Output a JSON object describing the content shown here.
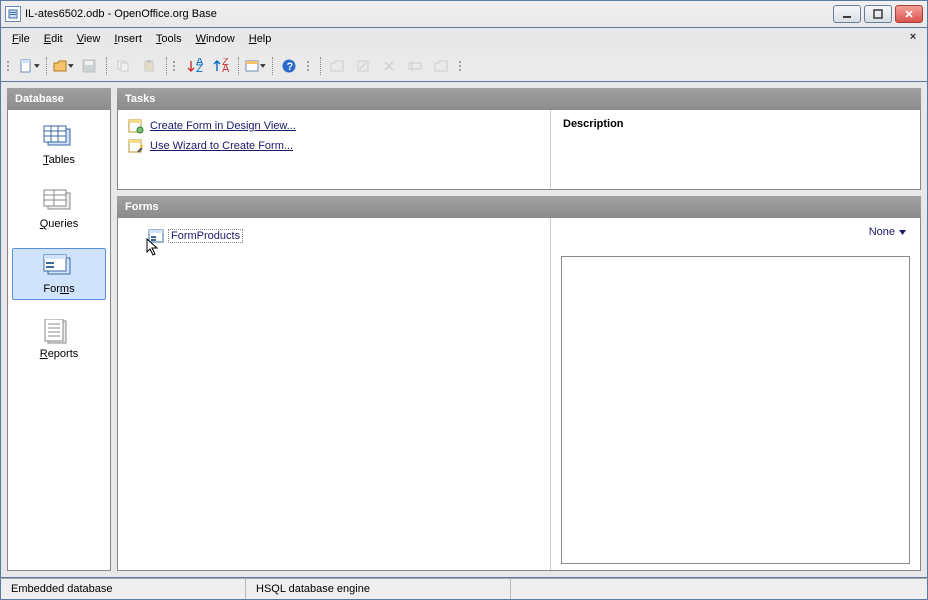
{
  "window": {
    "title": "IL-ates6502.odb - OpenOffice.org Base"
  },
  "menu": {
    "file": "File",
    "edit": "Edit",
    "view": "View",
    "insert": "Insert",
    "tools": "Tools",
    "window": "Window",
    "help": "Help"
  },
  "sidebar": {
    "header": "Database",
    "tables": "Tables",
    "queries": "Queries",
    "forms": "Forms",
    "reports": "Reports"
  },
  "tasks": {
    "header": "Tasks",
    "create_design": "Create Form in Design View...",
    "use_wizard": "Use Wizard to Create Form...",
    "description_label": "Description"
  },
  "forms": {
    "header": "Forms",
    "items": [
      {
        "name": "FormProducts"
      }
    ],
    "preview_mode": "None"
  },
  "status": {
    "left": "Embedded database",
    "engine": "HSQL database engine"
  }
}
